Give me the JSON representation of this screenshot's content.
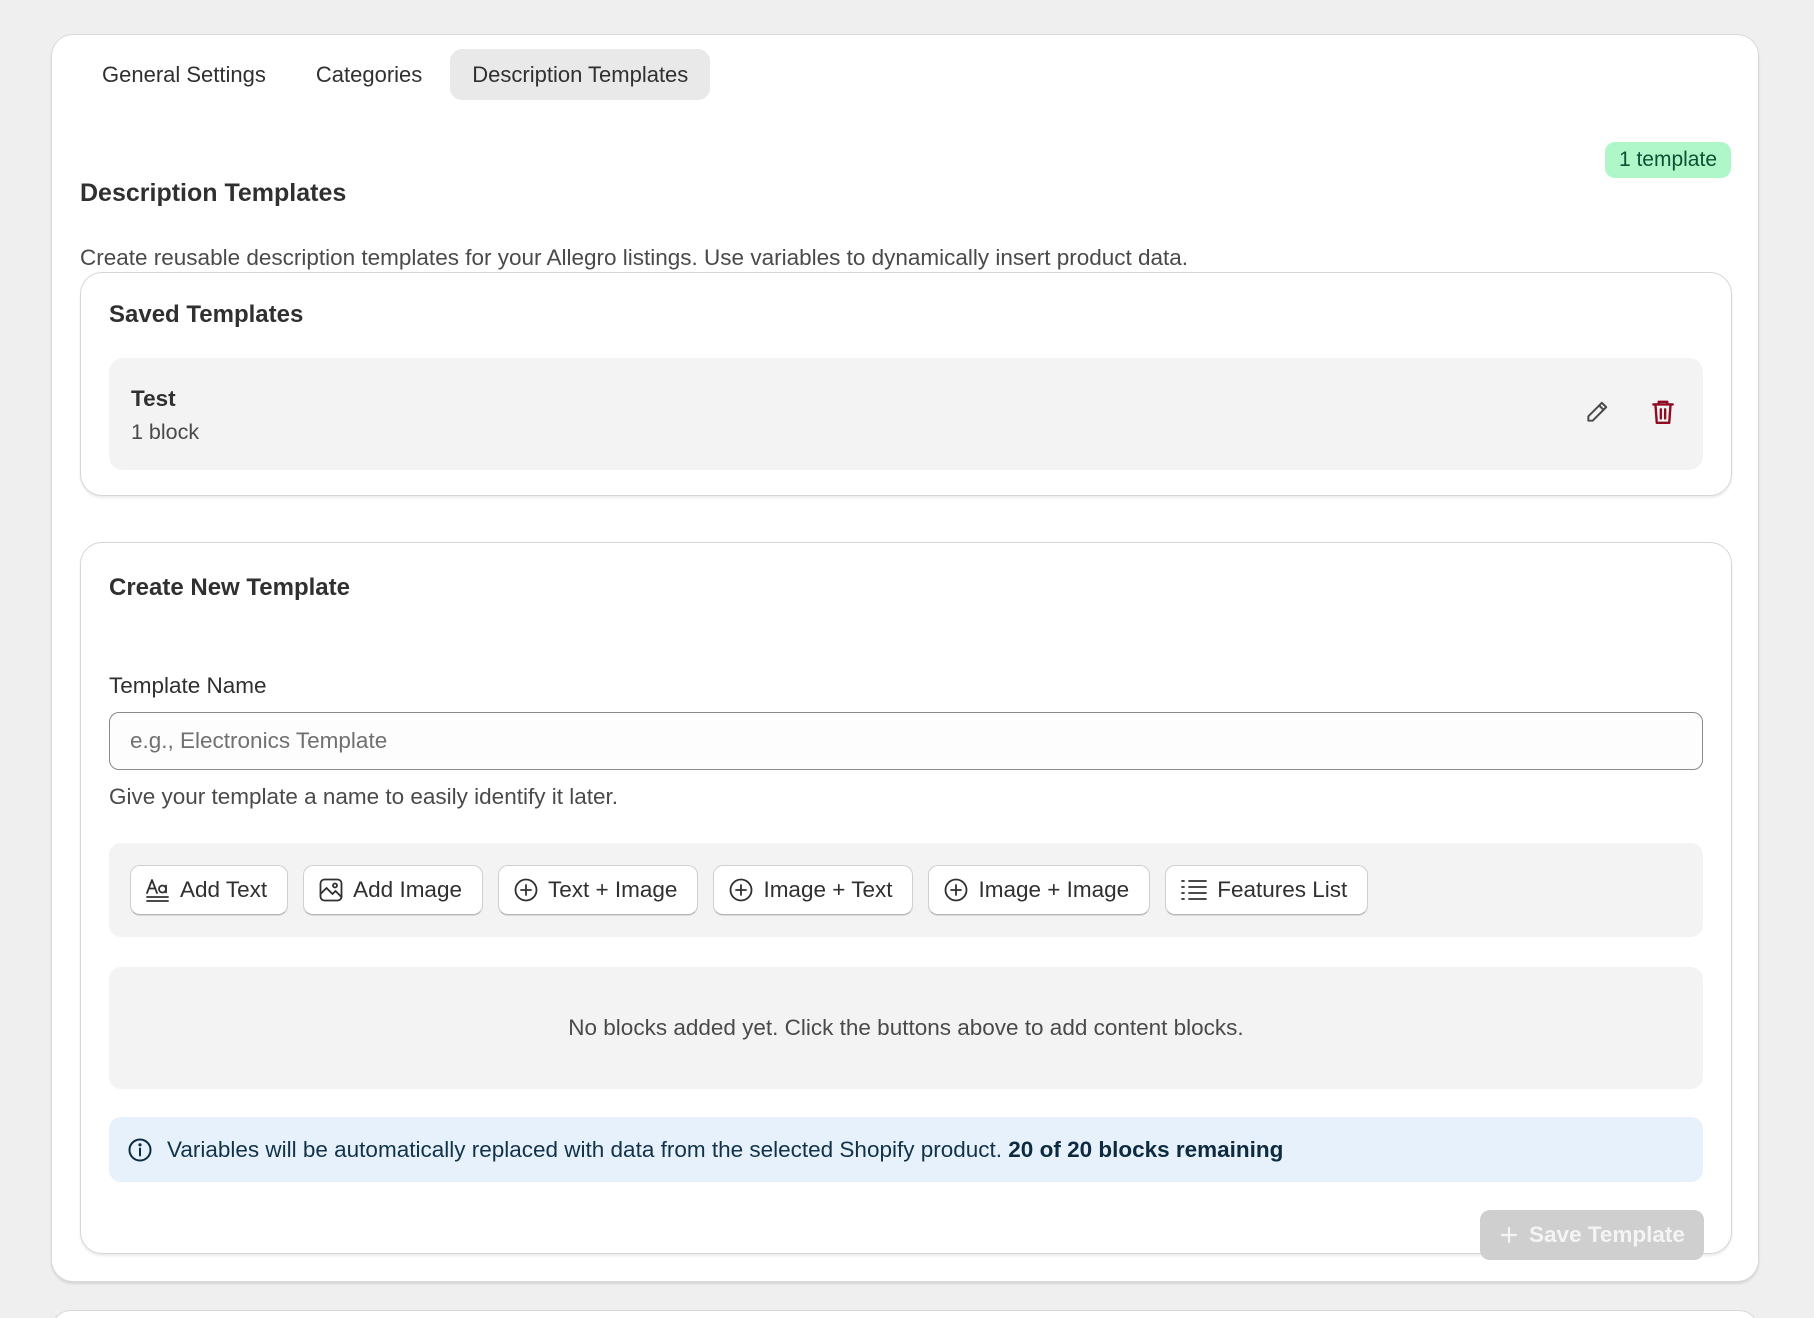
{
  "tabs": [
    {
      "label": "General Settings",
      "active": false
    },
    {
      "label": "Categories",
      "active": false
    },
    {
      "label": "Description Templates",
      "active": true
    }
  ],
  "section": {
    "title": "Description Templates",
    "badge": "1 template",
    "description": "Create reusable description templates for your Allegro listings. Use variables to dynamically insert product data."
  },
  "saved": {
    "title": "Saved Templates",
    "templates": [
      {
        "name": "Test",
        "meta": "1 block"
      }
    ]
  },
  "create": {
    "title": "Create New Template",
    "name_label": "Template Name",
    "name_value": "",
    "name_placeholder": "e.g., Electronics Template",
    "name_help": "Give your template a name to easily identify it later.",
    "block_buttons": [
      {
        "label": "Add Text",
        "icon": "text-format-icon"
      },
      {
        "label": "Add Image",
        "icon": "image-icon"
      },
      {
        "label": "Text + Image",
        "icon": "plus-circle-icon"
      },
      {
        "label": "Image + Text",
        "icon": "plus-circle-icon"
      },
      {
        "label": "Image + Image",
        "icon": "plus-circle-icon"
      },
      {
        "label": "Features List",
        "icon": "list-icon"
      }
    ],
    "empty_text": "No blocks added yet. Click the buttons above to add content blocks.",
    "info_text": "Variables will be automatically replaced with data from the selected Shopify product.",
    "info_strong": "20 of 20 blocks remaining",
    "save_label": "Save Template"
  },
  "colors": {
    "badge_bg": "#aff6c9",
    "badge_text": "#0c5132",
    "delete_icon": "#8e0b21",
    "info_bg": "#e6f1fb",
    "save_disabled_bg": "#cfcfcf"
  }
}
